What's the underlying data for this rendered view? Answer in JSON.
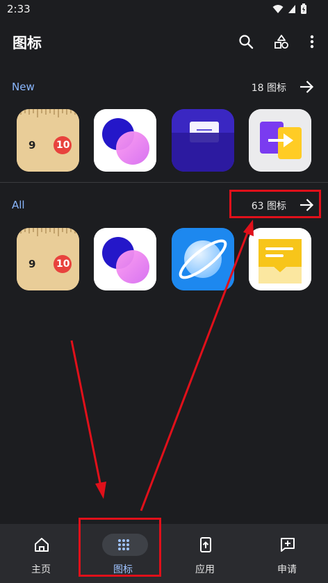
{
  "status_bar": {
    "time": "2:33"
  },
  "app_bar": {
    "title": "图标"
  },
  "sections": {
    "new": {
      "label": "New",
      "count": "18 图标"
    },
    "all": {
      "label": "All",
      "count": "63 图标"
    }
  },
  "icons": {
    "ruler_numbers": [
      "9",
      "10"
    ]
  },
  "bottom_nav": {
    "home": "主页",
    "icons": "图标",
    "apps": "应用",
    "request": "申请"
  },
  "colors": {
    "accent": "#8ab7ff",
    "annotation": "#e0101a",
    "background": "#1c1d20"
  }
}
